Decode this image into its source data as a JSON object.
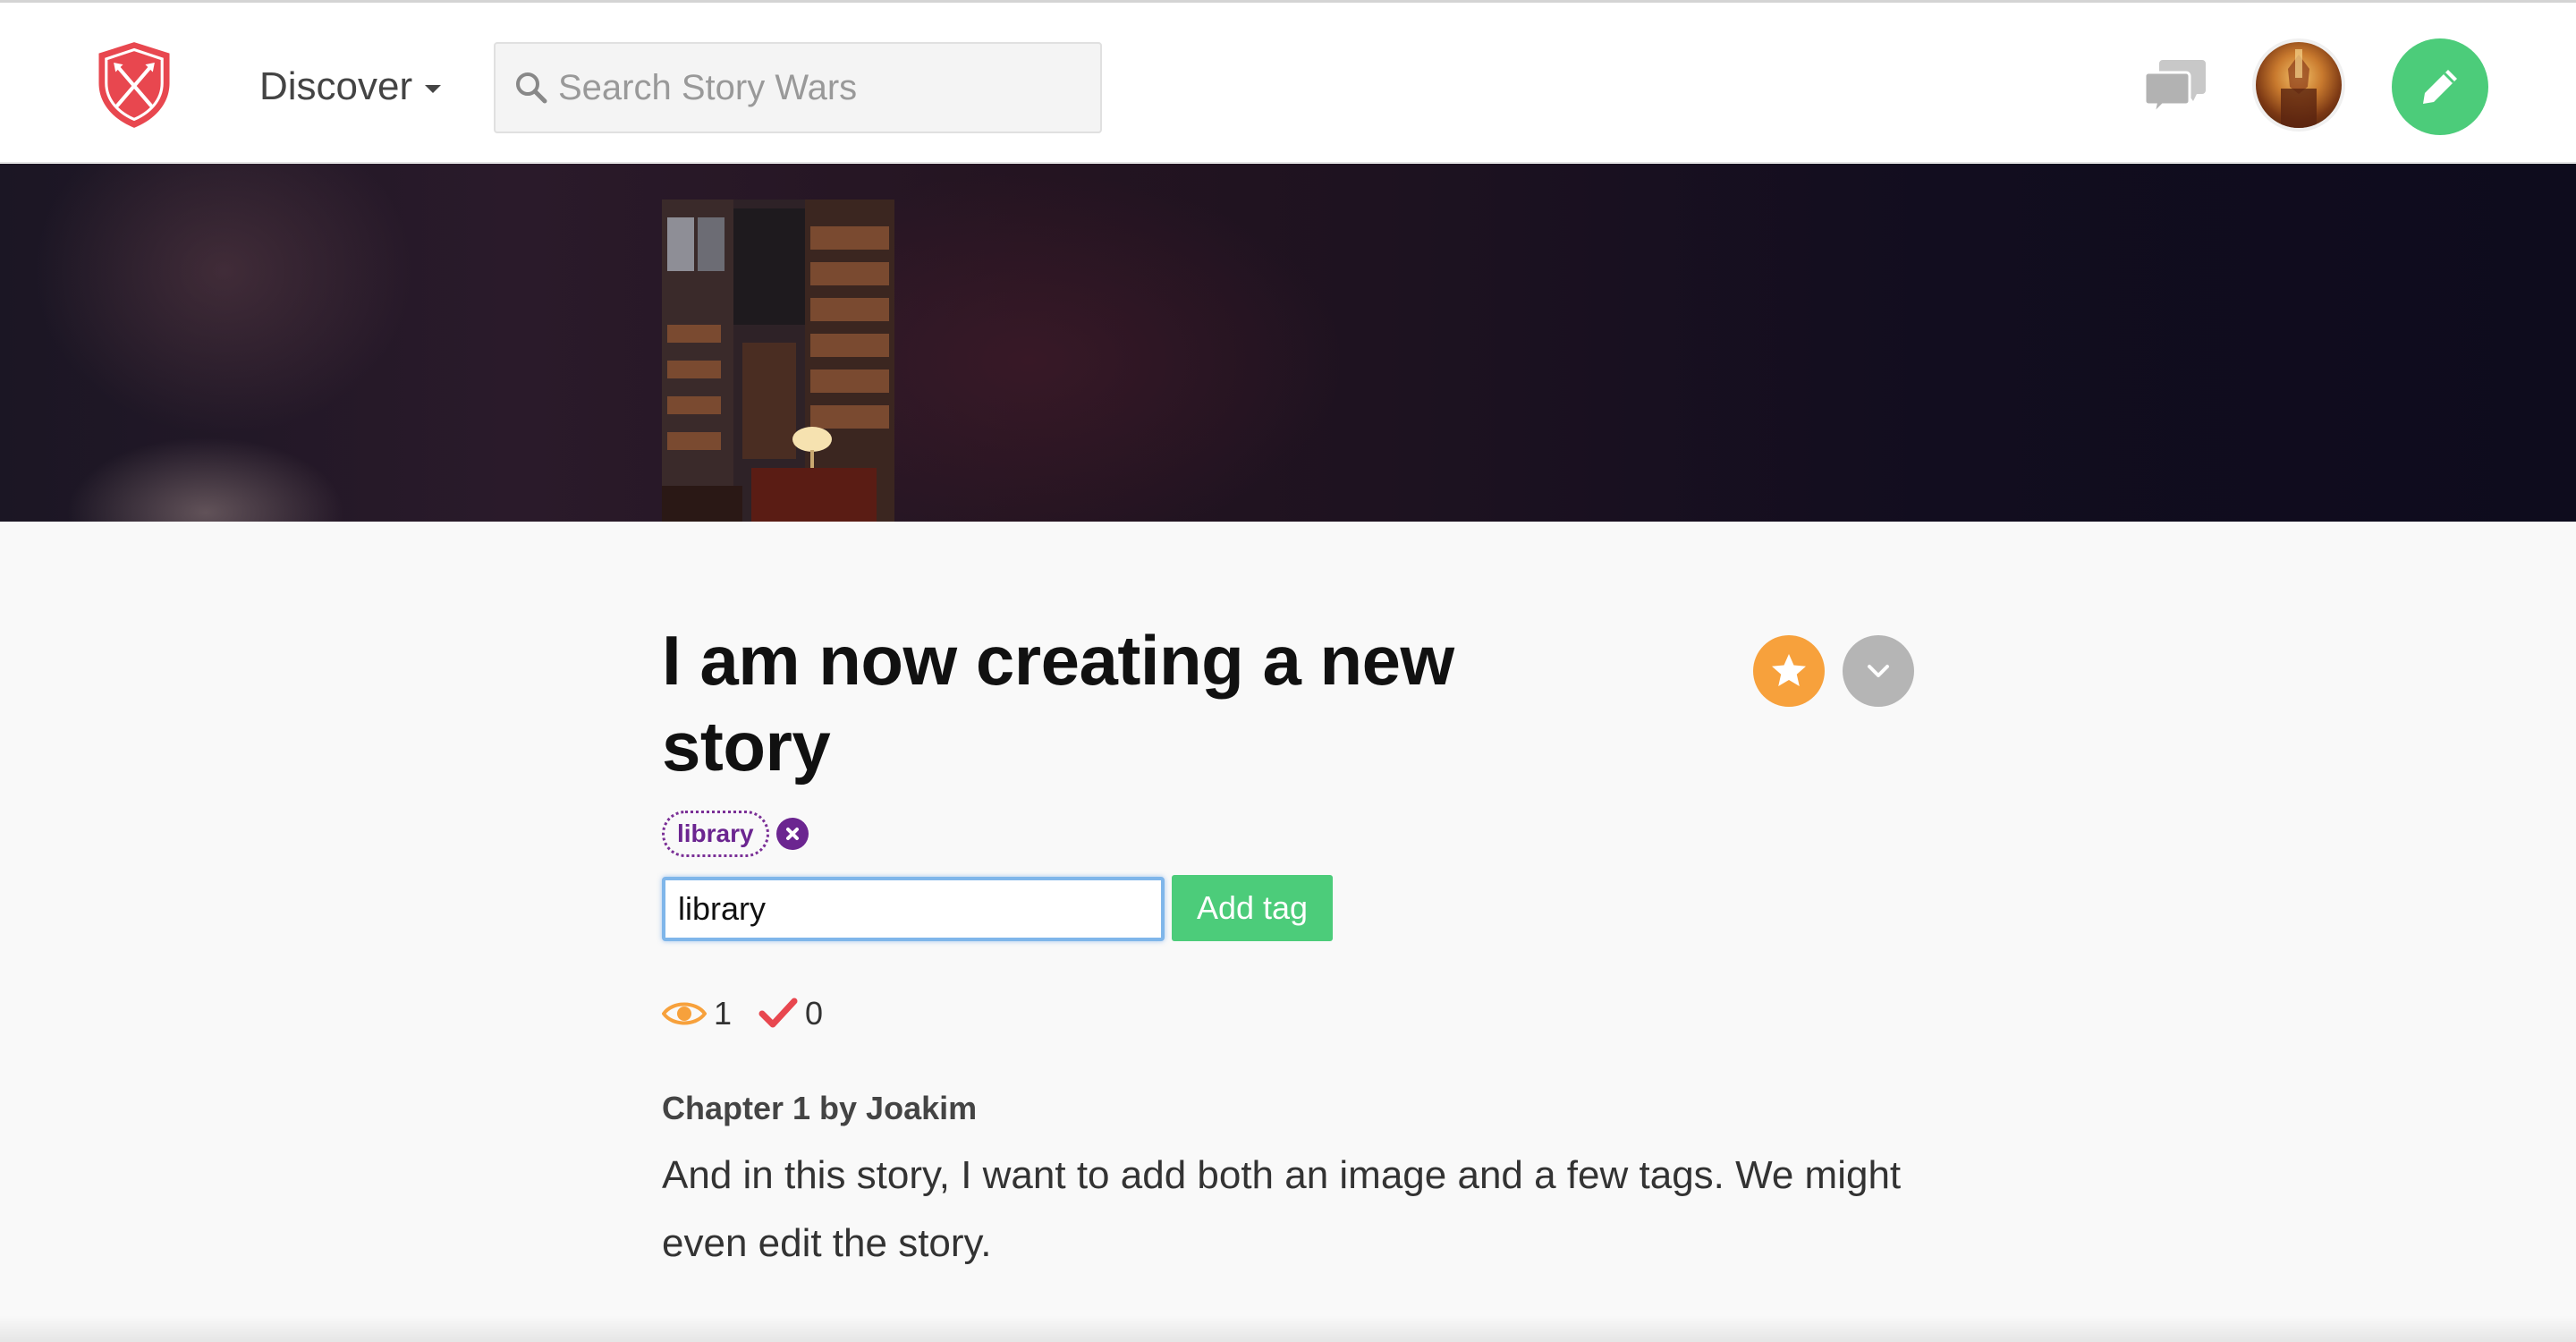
{
  "nav": {
    "discover_label": "Discover",
    "search_placeholder": "Search Story Wars"
  },
  "colors": {
    "brand_red": "#e8474f",
    "accent_green": "#4ccc7a",
    "star_orange": "#f7a13c",
    "tag_purple": "#6b2590",
    "focus_blue": "#7fb6ea"
  },
  "icons": {
    "logo": "crossed-swords-shield-icon",
    "search": "search-icon",
    "chat": "chat-bubbles-icon",
    "compose": "pencil-icon",
    "favorite": "star-icon",
    "more": "chevron-down-icon",
    "tag_remove": "close-icon",
    "views": "eye-icon",
    "votes": "checkmark-icon"
  },
  "story": {
    "title": "I am now creating a new story",
    "tags": [
      {
        "label": "library"
      }
    ],
    "tag_input_value": "library",
    "add_tag_label": "Add tag",
    "views": "1",
    "votes": "0",
    "chapter_heading": "Chapter 1 by Joakim",
    "chapter_text": "And in this story, I want to add both an image and a few tags. We might even edit the story."
  }
}
